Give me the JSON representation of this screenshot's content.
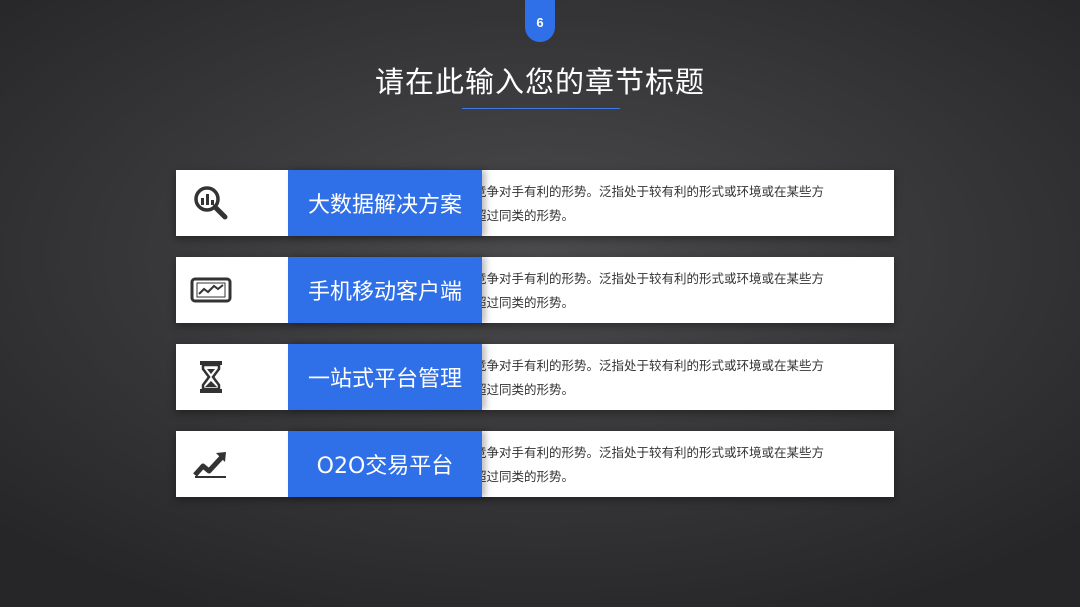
{
  "page_number": "6",
  "title": "请在此输入您的章节标题",
  "rows": [
    {
      "icon": "magnifier-chart-icon",
      "label": "大数据解决方案",
      "desc_line1": "竞争对手有利的形势。泛指处于较有利的形式或环境或在某些方",
      "desc_line2": "超过同类的形势。"
    },
    {
      "icon": "tablet-chart-icon",
      "label": "手机移动客户端",
      "desc_line1": "竞争对手有利的形势。泛指处于较有利的形式或环境或在某些方",
      "desc_line2": "超过同类的形势。"
    },
    {
      "icon": "hourglass-icon",
      "label": "一站式平台管理",
      "desc_line1": "竞争对手有利的形势。泛指处于较有利的形式或环境或在某些方",
      "desc_line2": "超过同类的形势。"
    },
    {
      "icon": "trend-up-icon",
      "label": "O2O交易平台",
      "desc_line1": "竞争对手有利的形势。泛指处于较有利的形式或环境或在某些方",
      "desc_line2": "超过同类的形势。"
    }
  ],
  "colors": {
    "accent": "#2f6fe8",
    "background": "#3a3a3c",
    "icon": "#333333"
  }
}
